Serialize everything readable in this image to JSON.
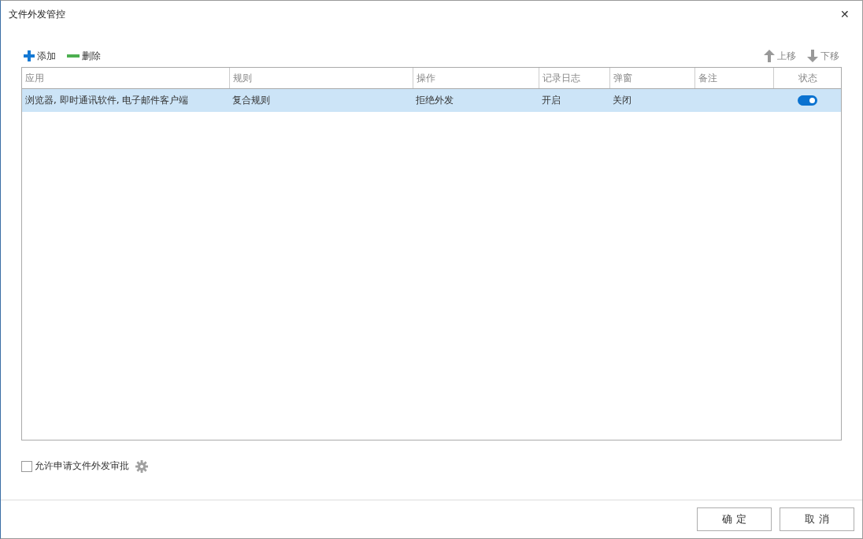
{
  "window": {
    "title": "文件外发管控",
    "close": "✕"
  },
  "toolbar": {
    "add": "添加",
    "delete": "删除",
    "move_up": "上移",
    "move_down": "下移"
  },
  "table": {
    "columns": [
      "应用",
      "规则",
      "操作",
      "记录日志",
      "弹窗",
      "备注",
      "状态"
    ],
    "rows": [
      {
        "selected": true,
        "cells": [
          "浏览器, 即时通讯软件, 电子邮件客户端",
          "复合规则",
          "拒绝外发",
          "开启",
          "关闭",
          ""
        ],
        "enabled": true
      }
    ]
  },
  "approval": {
    "label": "允许申请文件外发审批",
    "checked": false
  },
  "buttons": [
    "确 定",
    "取 消"
  ]
}
